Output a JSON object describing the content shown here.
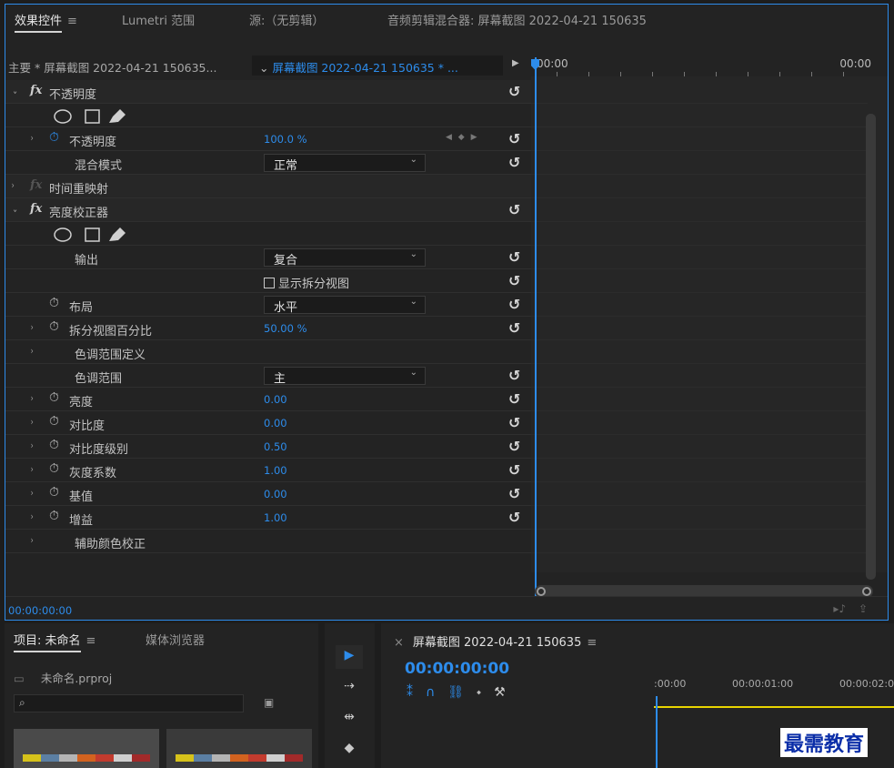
{
  "effect_controls": {
    "tabs": [
      {
        "label": "效果控件",
        "active": true
      },
      {
        "label": "Lumetri 范围"
      },
      {
        "label": "源:（无剪辑）"
      },
      {
        "label": "音频剪辑混合器: 屏幕截图 2022-04-21 150635"
      }
    ],
    "menu_icon": "≡",
    "source_main": "主要 * 屏幕截图 2022-04-21 150635...",
    "sequence_clip": "屏幕截图 2022-04-21 150635 * ...",
    "timeline_start": "00:00",
    "timeline_end": "00:00",
    "timecode": "00:00:00:00",
    "rows": {
      "opacity_header": "不透明度",
      "opacity": {
        "label": "不透明度",
        "value": "100.0 %"
      },
      "blend_mode": {
        "label": "混合模式",
        "value": "正常"
      },
      "time_remap": "时间重映射",
      "brightness_correct": "亮度校正器",
      "output": {
        "label": "输出",
        "value": "复合"
      },
      "show_split": "显示拆分视图",
      "layout": {
        "label": "布局",
        "value": "水平"
      },
      "split_percent": {
        "label": "拆分视图百分比",
        "value": "50.00 %"
      },
      "tonal_range_def": "色调范围定义",
      "tonal_range": {
        "label": "色调范围",
        "value": "主"
      },
      "brightness": {
        "label": "亮度",
        "value": "0.00"
      },
      "contrast": {
        "label": "对比度",
        "value": "0.00"
      },
      "contrast_level": {
        "label": "对比度级别",
        "value": "0.50"
      },
      "gamma": {
        "label": "灰度系数",
        "value": "1.00"
      },
      "pedestal": {
        "label": "基值",
        "value": "0.00"
      },
      "gain": {
        "label": "增益",
        "value": "1.00"
      },
      "secondary": "辅助颜色校正"
    }
  },
  "project": {
    "tab_active": "项目: 未命名",
    "tab_menu": "≡",
    "tab_media": "媒体浏览器",
    "file": "未命名.prproj"
  },
  "sequence": {
    "tab": "屏幕截图 2022-04-21 150635",
    "tab_menu": "≡",
    "close": "×",
    "timecode": "00:00:00:00",
    "ruler": [
      ":00:00",
      "00:00:01:00",
      "00:00:02:0"
    ]
  },
  "watermark": "最需教育",
  "colors": {
    "accent": "#2d8ceb",
    "playhead_line": "#e8d400",
    "watermark": "#0b2ea8"
  }
}
